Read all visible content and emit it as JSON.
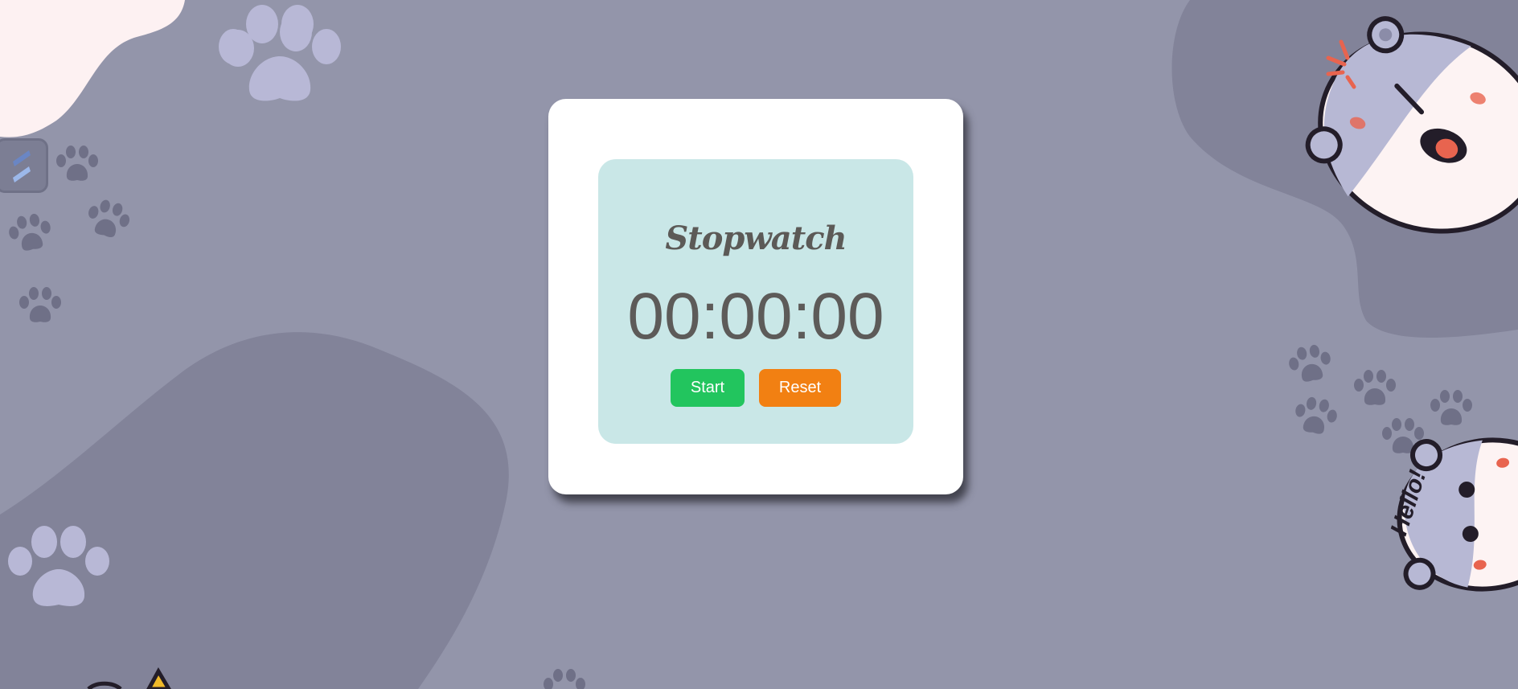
{
  "stopwatch": {
    "title": "Stopwatch",
    "time": "00:00:00",
    "start_label": "Start",
    "reset_label": "Reset"
  },
  "decoration": {
    "sticker_text": "Hello!"
  },
  "colors": {
    "background": "#9395aa",
    "panel": "#c9e7e7",
    "start": "#22c55e",
    "reset": "#f28012",
    "text": "#5d5b59"
  },
  "icons": {
    "side_badge": "s-logo-icon"
  }
}
